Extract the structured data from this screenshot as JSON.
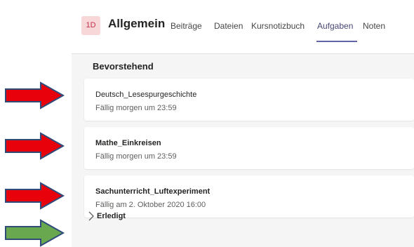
{
  "header": {
    "avatar_initials": "1D",
    "channel_name": "Allgemein",
    "tabs": [
      {
        "label": "Beiträge"
      },
      {
        "label": "Dateien"
      },
      {
        "label": "Kursnotizbuch"
      },
      {
        "label": "Aufgaben"
      },
      {
        "label": "Noten"
      }
    ],
    "active_tab": "Aufgaben"
  },
  "sections": {
    "upcoming_title": "Bevorstehend",
    "done_title": "Erledigt"
  },
  "assignments": [
    {
      "title": "Deutsch_Lesespurgeschichte",
      "due": "Fällig morgen um 23:59"
    },
    {
      "title": "Mathe_Einkreisen",
      "due": "Fällig morgen um 23:59"
    },
    {
      "title": "Sachunterricht_Luftexperiment",
      "due": "Fällig am 2. Oktober 2020 16:00"
    }
  ],
  "annotations": {
    "arrow_colors": {
      "red": "#e8000b",
      "green": "#6aa84f",
      "outline": "#2f4b7c"
    }
  },
  "colors": {
    "accent": "#6264a7",
    "avatar_bg": "#f7d7d8",
    "panel_bg": "#f5f5f5"
  }
}
